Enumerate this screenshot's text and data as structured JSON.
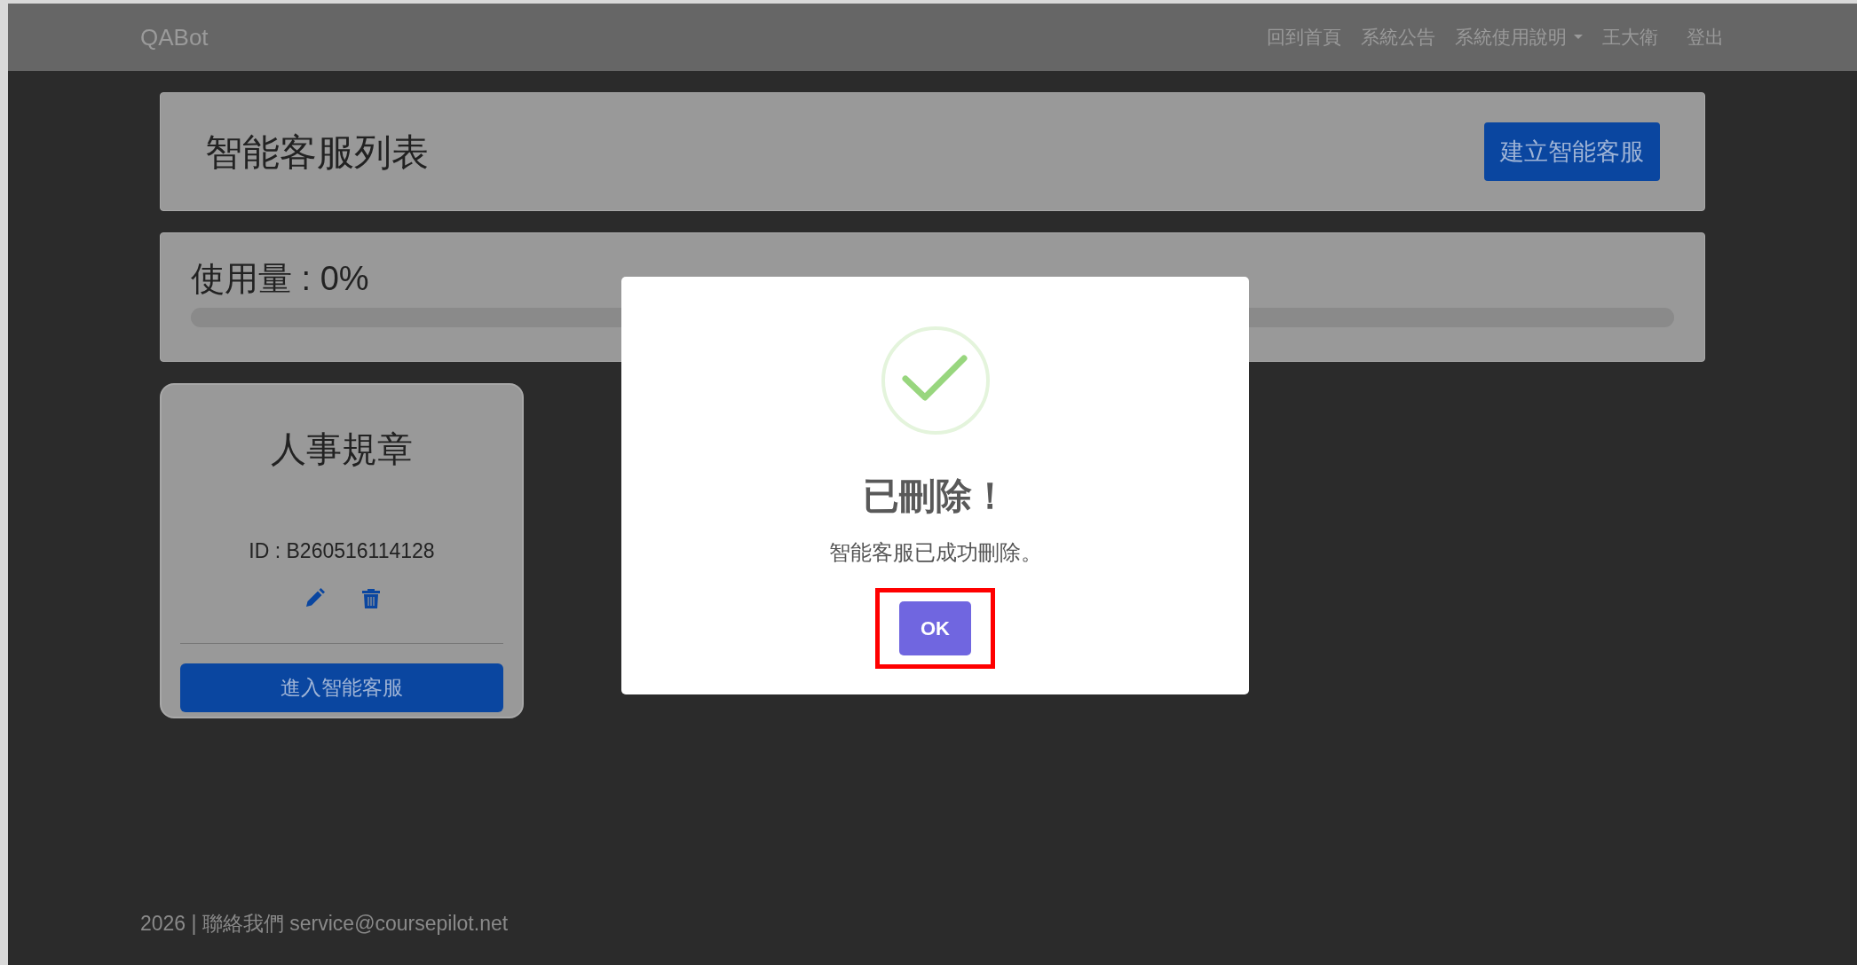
{
  "navbar": {
    "brand": "QABot",
    "links": [
      {
        "label": "回到首頁",
        "kind": "link"
      },
      {
        "label": "系統公告",
        "kind": "link"
      },
      {
        "label": "系統使用說明",
        "kind": "dropdown"
      },
      {
        "label": "王大衛",
        "kind": "link"
      },
      {
        "label": "登出",
        "kind": "link"
      }
    ]
  },
  "header": {
    "title": "智能客服列表",
    "create_button": "建立智能客服"
  },
  "usage": {
    "label": "使用量 : 0%",
    "level": 0
  },
  "bots": [
    {
      "name": "人事規章",
      "id": "ID : B260516114128",
      "enter_button": "進入智能客服"
    }
  ],
  "dialog": {
    "title": "已刪除！",
    "message": "智能客服已成功刪除。",
    "button": {
      "label": "OK",
      "highlighted": true
    }
  },
  "footer": {
    "text": "2026 | 聯絡我們 service@coursepilot.net"
  }
}
